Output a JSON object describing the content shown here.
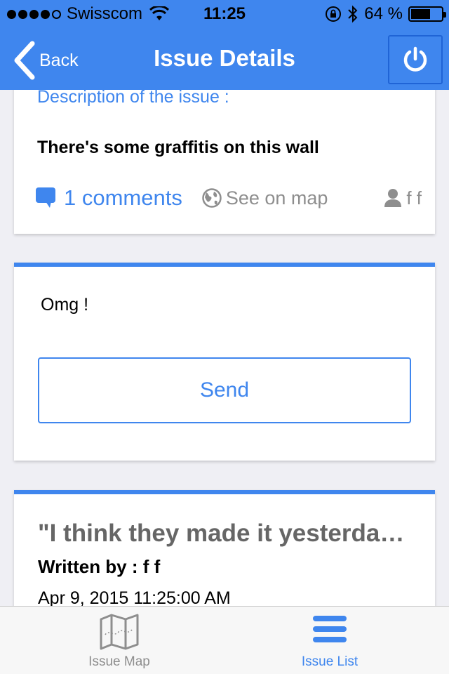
{
  "status_bar": {
    "carrier": "Swisscom",
    "time": "11:25",
    "battery": "64 %",
    "battery_level": 0.64
  },
  "nav": {
    "back_label": "Back",
    "title": "Issue Details"
  },
  "issue": {
    "description_label": "Description of the issue :",
    "description": "There's some graffitis on this wall",
    "comments_link": "1 comments",
    "map_link": "See on map",
    "author": "f f"
  },
  "comment_form": {
    "input_value": "Omg !",
    "send_label": "Send"
  },
  "comments": [
    {
      "text": "\"I think they made it yesterday ...",
      "written_by": "Written by : f f",
      "date": "Apr 9, 2015 11:25:00 AM"
    }
  ],
  "tabbar": {
    "items": [
      {
        "label": "Issue Map",
        "icon": "map-icon",
        "active": false
      },
      {
        "label": "Issue List",
        "icon": "list-icon",
        "active": true
      }
    ]
  },
  "colors": {
    "accent": "#3f86ee",
    "inactive": "#8e8e8e"
  }
}
